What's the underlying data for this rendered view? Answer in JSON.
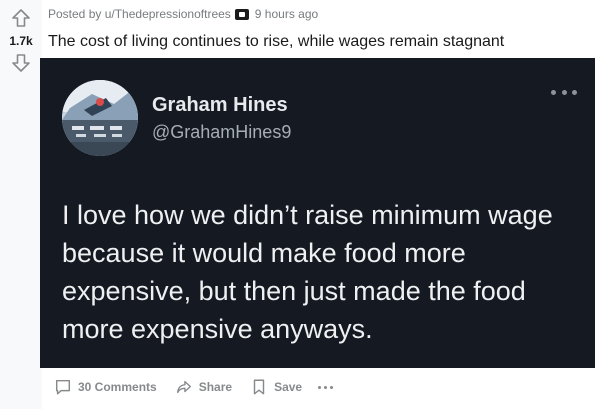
{
  "post": {
    "score": "1.7k",
    "posted_by_prefix": "Posted by",
    "author": "u/Thedepressionoftrees",
    "time": "9 hours ago",
    "title": "The cost of living continues to rise, while wages remain stagnant"
  },
  "tweet": {
    "name": "Graham Hines",
    "handle": "@GrahamHines9",
    "text": "I love how we didn’t raise minimum wage because it would make food more expensive, but then just made the food more expensive anyways."
  },
  "actions": {
    "comments": "30 Comments",
    "share": "Share",
    "save": "Save"
  },
  "icons": {
    "upvote": "arrow-up-icon",
    "downvote": "arrow-down-icon",
    "comment": "comment-icon",
    "share": "share-icon",
    "save": "bookmark-icon",
    "more": "more-icon"
  },
  "colors": {
    "vote_bg": "#f8f9fa",
    "meta_text": "#787c7e",
    "tweet_bg": "#151921",
    "action_text": "#878a8c"
  }
}
